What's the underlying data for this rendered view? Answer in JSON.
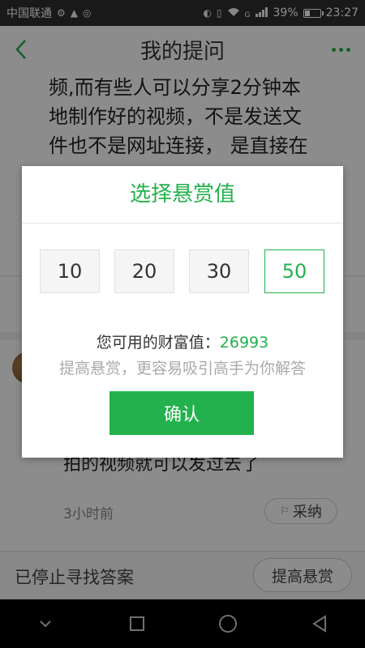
{
  "status_bar": {
    "carrier": "中国联通",
    "network": "G",
    "battery": "39%",
    "battery_level": 0.39,
    "time": "23:27"
  },
  "header": {
    "title": "我的提问",
    "back_icon": "chevron-left-icon",
    "more_icon": "more-dots-icon",
    "accent": "#23b14d"
  },
  "question": {
    "lines": [
      "频,而有些人可以分享2分钟本",
      "地制作好的视频，不是发送文",
      "件也不是网址连接， 是直接在"
    ]
  },
  "answer": {
    "text": "拍的视频就可以发过去了",
    "time": "3小时前",
    "adopt_label": "采纳"
  },
  "bottom_bar": {
    "status": "已停止寻找答案",
    "raise_label": "提高悬赏"
  },
  "dialog": {
    "title": "选择悬赏值",
    "options": [
      "10",
      "20",
      "30",
      "50"
    ],
    "selected": "50",
    "wealth_label": "您可用的财富值：",
    "wealth_value": "26993",
    "hint": "提高悬赏，更容易吸引高手为你解答",
    "confirm_label": "确认"
  },
  "colors": {
    "accent": "#23b14d",
    "overlay": "rgba(0,0,0,0.45)"
  }
}
